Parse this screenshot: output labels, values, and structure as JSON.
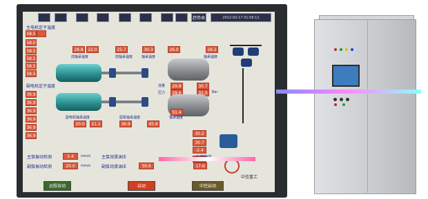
{
  "toolbar": {
    "buttons": [
      "",
      "",
      "",
      "",
      "",
      "",
      "",
      "",
      "",
      "趋势曲线"
    ],
    "datetime": "2012-02-17  01:56:11"
  },
  "top_section": {
    "title": "主电机定子温度",
    "stator_temps": [
      "58.5",
      "",
      "58.0",
      "58.5",
      "58.5",
      "58.5",
      "58.5"
    ],
    "values": [
      "28.8",
      "22.0",
      "25.7",
      "30.3",
      "26.0",
      "26.2"
    ],
    "labels": [
      "前轴承温度",
      "前轴承温度",
      "前轴承温度",
      "轴承温度",
      "轴承温度"
    ]
  },
  "bottom_section": {
    "title": "副电机定子温度",
    "stator_temps": [
      "36.9",
      "36.9",
      "36.9",
      "36.9",
      "36.9",
      "36.9"
    ],
    "values": [
      "20.0",
      "21.1",
      "36.9",
      "45.9",
      "51.4"
    ],
    "labels": [
      "副电机轴承温度",
      "副泵轴承温度",
      "轴承温度"
    ]
  },
  "mid": {
    "flow_label": "流量",
    "pressure_label": "压力",
    "values_top": [
      "29.8",
      "30.7"
    ],
    "values_bottom": [
      "29.6",
      "31.5"
    ],
    "unit_bar": "Bar",
    "side_values": [
      "30.2",
      "30.7",
      "-2.4",
      "-2.4"
    ]
  },
  "footer": {
    "vib1_label": "主泵振动检测",
    "vib1_value": "5.4",
    "vib1_unit": "mm/s",
    "vib2_label": "副泵振动检测",
    "vib2_value": "20.0",
    "vib2_unit": "mm/s",
    "mid_labels": [
      "主泵润滑油压",
      "副泵润滑油压"
    ],
    "mid_values": [
      "",
      "30.6"
    ],
    "right_label": "水波轴压",
    "right_value": "17.6",
    "logo_text": "中信重工",
    "btn_left": "远程自动",
    "btn_mid": "启动",
    "btn_right": "中控启动"
  },
  "colors": {
    "screen_bg": "#e5e5dc",
    "value_box": "#d95a3c",
    "label_text": "#1e2a88",
    "btn_left": "#3a6a2a",
    "btn_mid": "#d04020",
    "btn_right": "#6a5a2a"
  }
}
